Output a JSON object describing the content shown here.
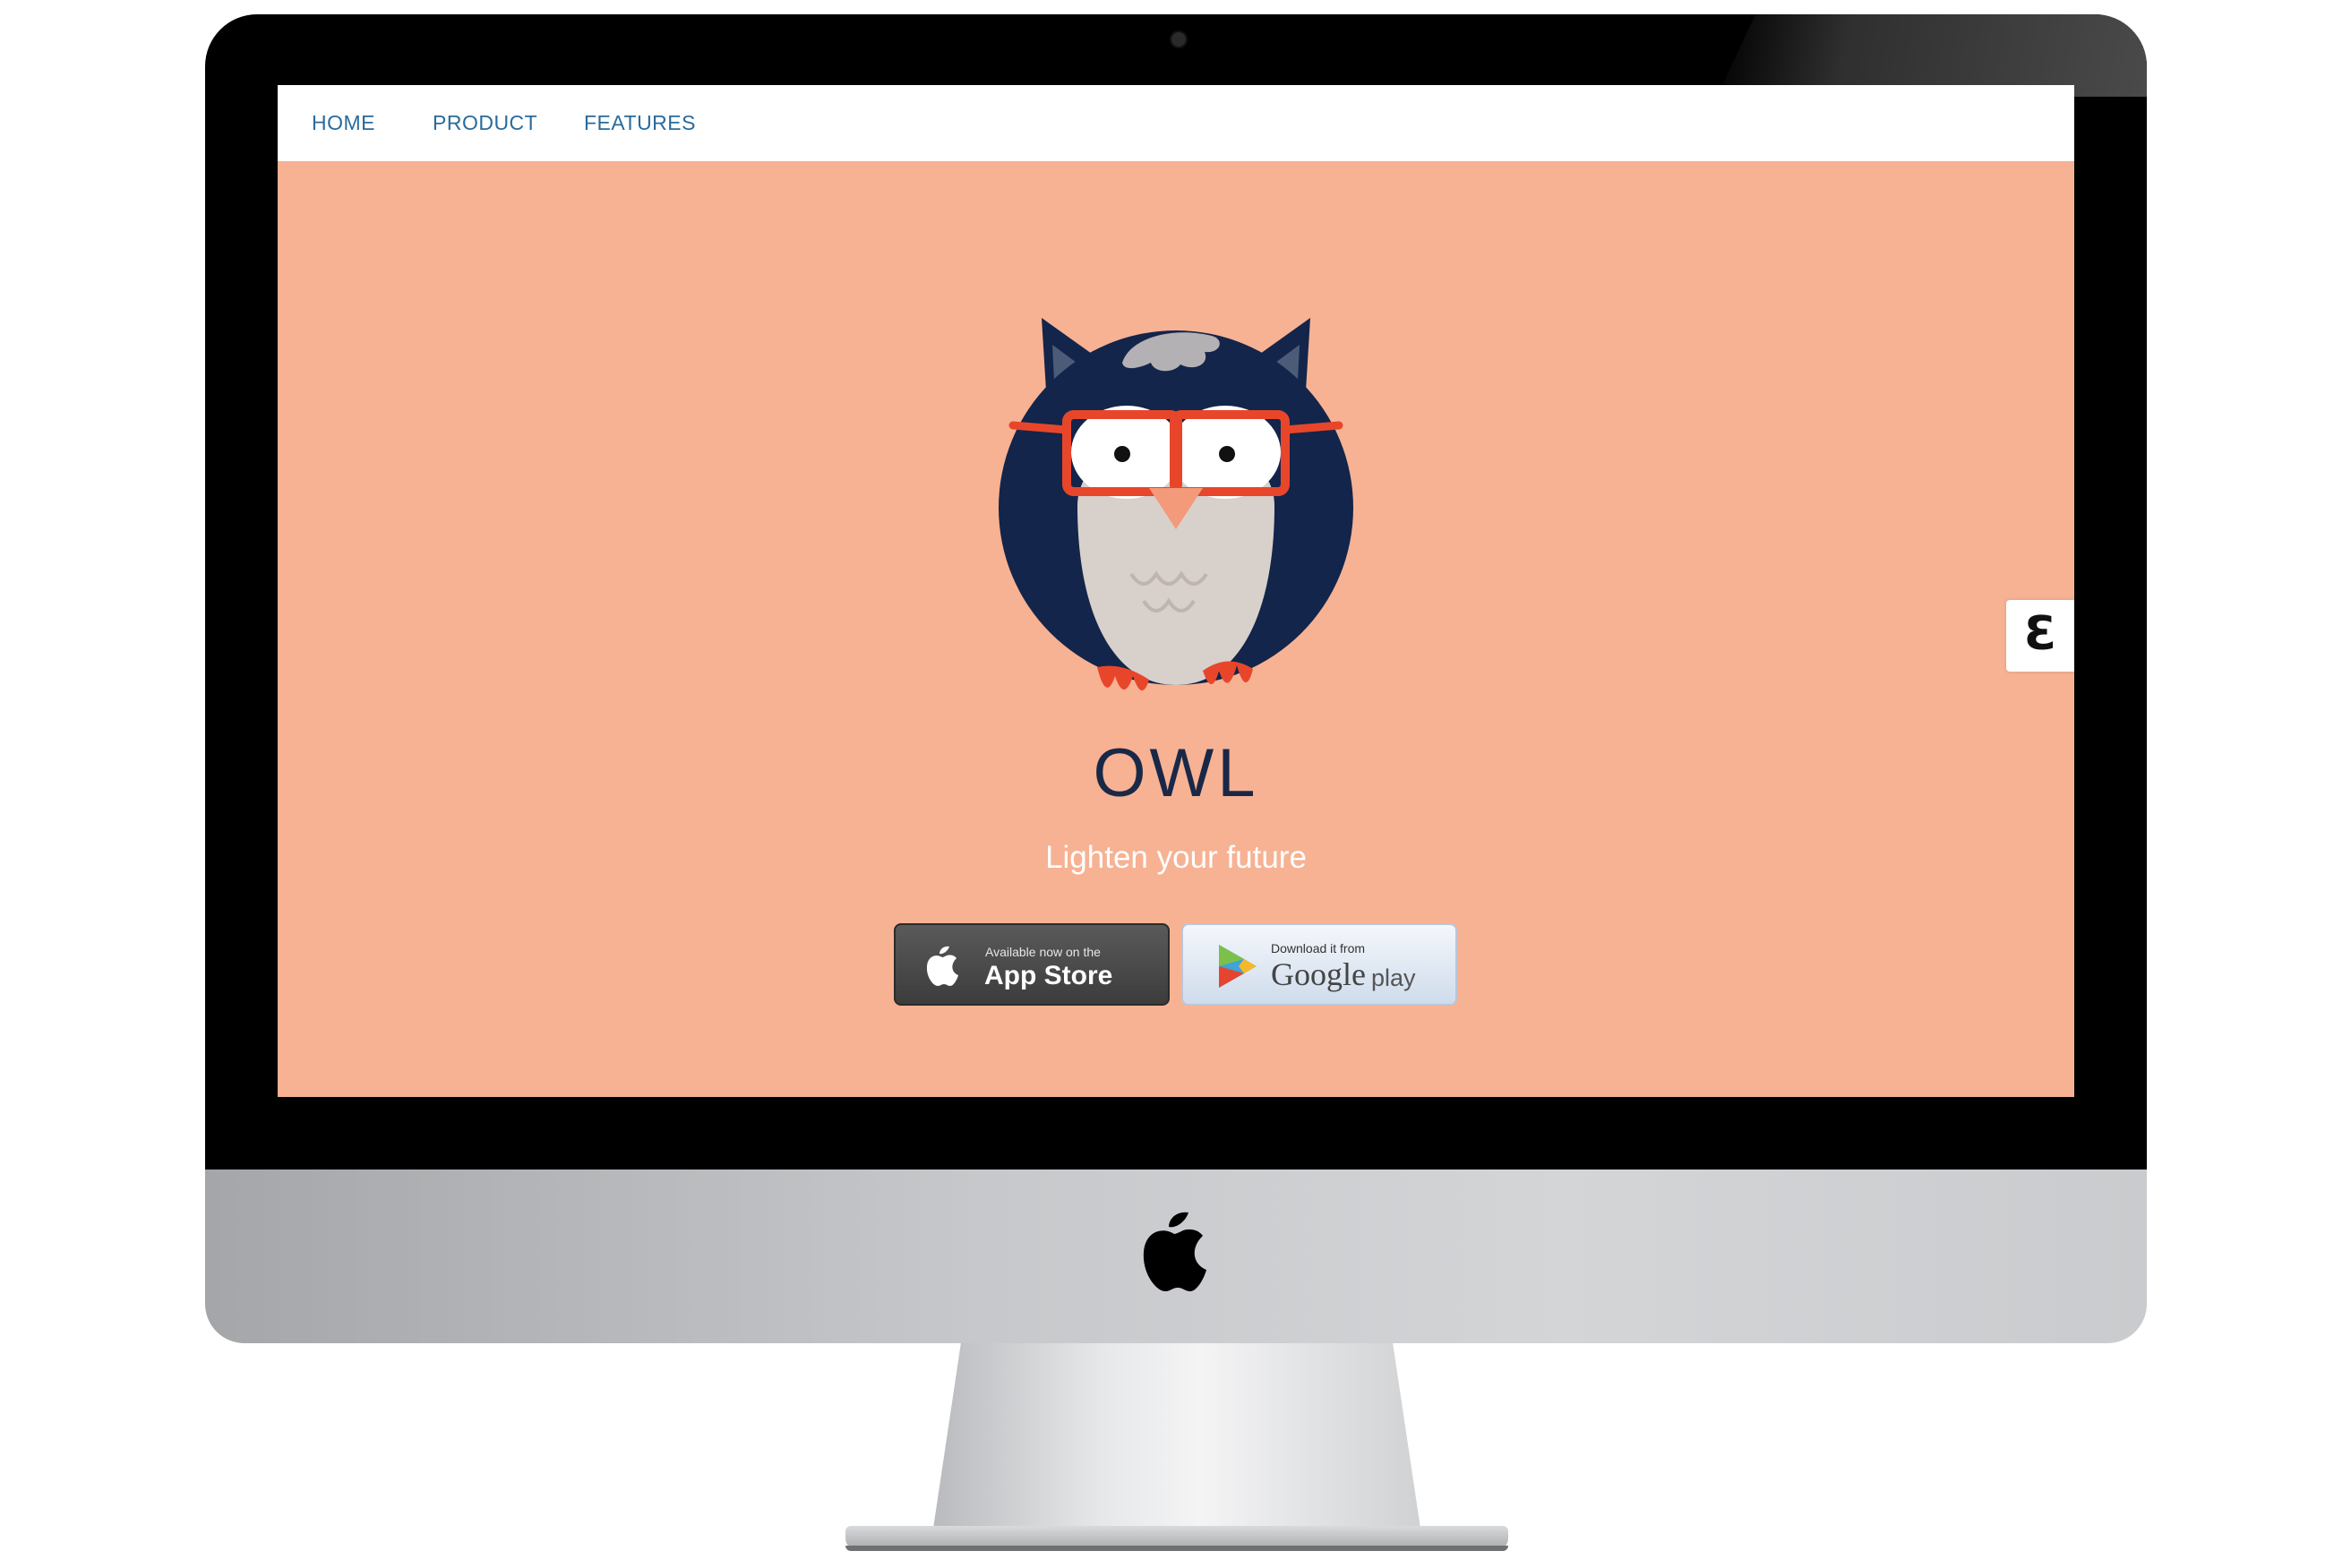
{
  "nav": {
    "items": [
      {
        "label": "HOME"
      },
      {
        "label": "PRODUCT"
      },
      {
        "label": "FEATURES"
      }
    ]
  },
  "hero": {
    "brand": "OWL",
    "tagline": "Lighten your future"
  },
  "store_buttons": {
    "app_store": {
      "small": "Available now on the",
      "big": "App Store",
      "icon": "apple-icon"
    },
    "google_play": {
      "small": "Download it from",
      "big": "Google",
      "big2": "play",
      "icon": "play-triangle-icon"
    }
  },
  "side_widget": {
    "glyph": "Ɛ"
  },
  "colors": {
    "background": "#f7b293",
    "nav_text": "#2a6b9c",
    "brand_text": "#1a2848",
    "owl_body": "#13254a",
    "glasses": "#e8462b"
  }
}
